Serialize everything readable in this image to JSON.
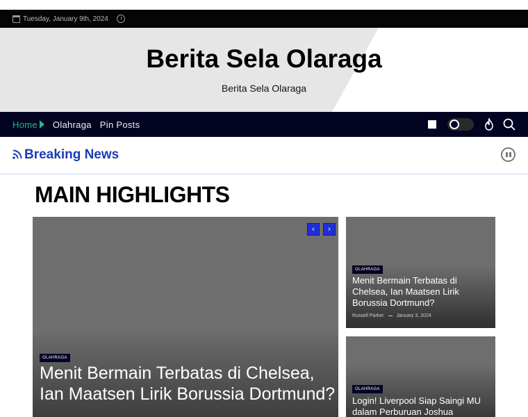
{
  "topbar": {
    "date": "Tuesday, January 9th, 2024"
  },
  "masthead": {
    "title": "Berita Sela Olaraga",
    "tagline": "Berita Sela Olaraga"
  },
  "nav": {
    "items": [
      {
        "label": "Home"
      },
      {
        "label": "Olahraga"
      },
      {
        "label": "Pin Posts"
      }
    ]
  },
  "breaking": {
    "title": "Breaking News"
  },
  "highlights": {
    "title": "MAIN HIGHLIGHTS",
    "slider_prev": "‹",
    "slider_next": "›",
    "main": {
      "category": "OLAHRAGA",
      "headline": "Menit Bermain Terbatas di Chelsea, Ian Maatsen Lirik Borussia Dortmund?"
    },
    "side": [
      {
        "category": "OLAHRAGA",
        "headline": "Menit Bermain Terbatas di Chelsea, Ian Maatsen Lirik Borussia Dortmund?",
        "author": "Russell Parker",
        "date": "January 3, 2024"
      },
      {
        "category": "OLAHRAGA",
        "headline": "Login! Liverpool Siap Saingi MU dalam Perburuan Joshua"
      }
    ]
  },
  "colors": {
    "nav_bg": "#030322",
    "accent_green": "#2fb38a",
    "breaking_blue": "#1b3bb7",
    "slider_blue": "#1f2fd6"
  }
}
